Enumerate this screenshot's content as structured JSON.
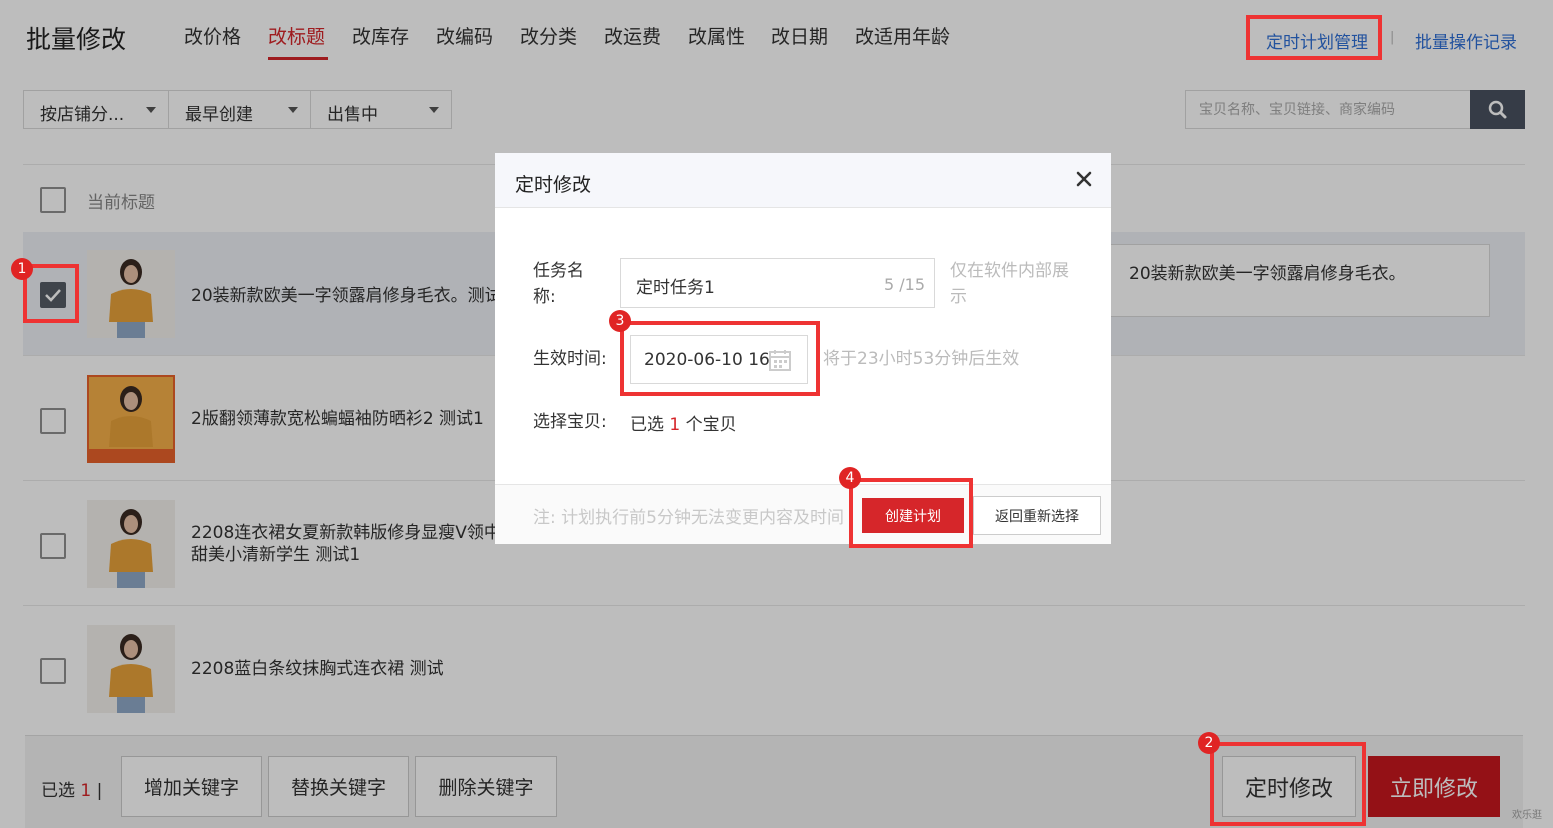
{
  "header": {
    "title": "批量修改",
    "tabs": [
      {
        "label": "改价格"
      },
      {
        "label": "改标题"
      },
      {
        "label": "改库存"
      },
      {
        "label": "改编码"
      },
      {
        "label": "改分类"
      },
      {
        "label": "改运费"
      },
      {
        "label": "改属性"
      },
      {
        "label": "改日期"
      },
      {
        "label": "改适用年龄"
      }
    ],
    "active_tab": "改标题",
    "schedule_manage": "定时计划管理",
    "separator": "|",
    "batch_log": "批量操作记录"
  },
  "filters": {
    "shop_category": "按店铺分...",
    "sort": "最早创建",
    "status": "出售中"
  },
  "search": {
    "placeholder": "宝贝名称、宝贝链接、商家编码"
  },
  "list": {
    "column_header": "当前标题",
    "rows": [
      {
        "title": "20装新款欧美一字领露肩修身毛衣。测试",
        "checked": true,
        "edit_value": "20装新款欧美一字领露肩修身毛衣。"
      },
      {
        "title": "2版翻领薄款宽松蝙蝠袖防晒衫2 测试1",
        "checked": false
      },
      {
        "title_line1": "2208连衣裙女夏新款韩版修身显瘦V领中",
        "title_line2": "甜美小清新学生 测试1",
        "checked": false
      },
      {
        "title": "2208蓝白条纹抹胸式连衣裙 测试",
        "checked": false
      }
    ]
  },
  "bottom_bar": {
    "selected_label": "已选",
    "selected_count": "1",
    "separator": "|",
    "add_keyword": "增加关键字",
    "replace_keyword": "替换关键字",
    "delete_keyword": "删除关键字",
    "scheduled_modify": "定时修改",
    "modify_now": "立即修改"
  },
  "modal": {
    "title": "定时修改",
    "task_name_label_1": "任务名",
    "task_name_label_2": "称:",
    "task_name_value": "定时任务1",
    "task_name_count": "5 /15",
    "task_name_hint_1": "仅在软件内部展",
    "task_name_hint_2": "示",
    "effective_time_label": "生效时间:",
    "effective_time_value": "2020-06-10 16",
    "effective_time_hint": "将于23小时53分钟后生效",
    "select_items_label": "选择宝贝:",
    "select_items_prefix": "已选",
    "select_items_count": "1",
    "select_items_suffix": "个宝贝",
    "footer_note": "注: 计划执行前5分钟无法变更内容及时间",
    "create_button": "创建计划",
    "back_button": "返回重新选择"
  },
  "annotations": {
    "badges": [
      "1",
      "2",
      "3",
      "4"
    ],
    "highlight_color": "#ee3333"
  },
  "watermark": "欢乐逛",
  "colors": {
    "accent_red": "#d6262a",
    "link_blue": "#2f6fd6",
    "search_button": "#4a5260"
  }
}
